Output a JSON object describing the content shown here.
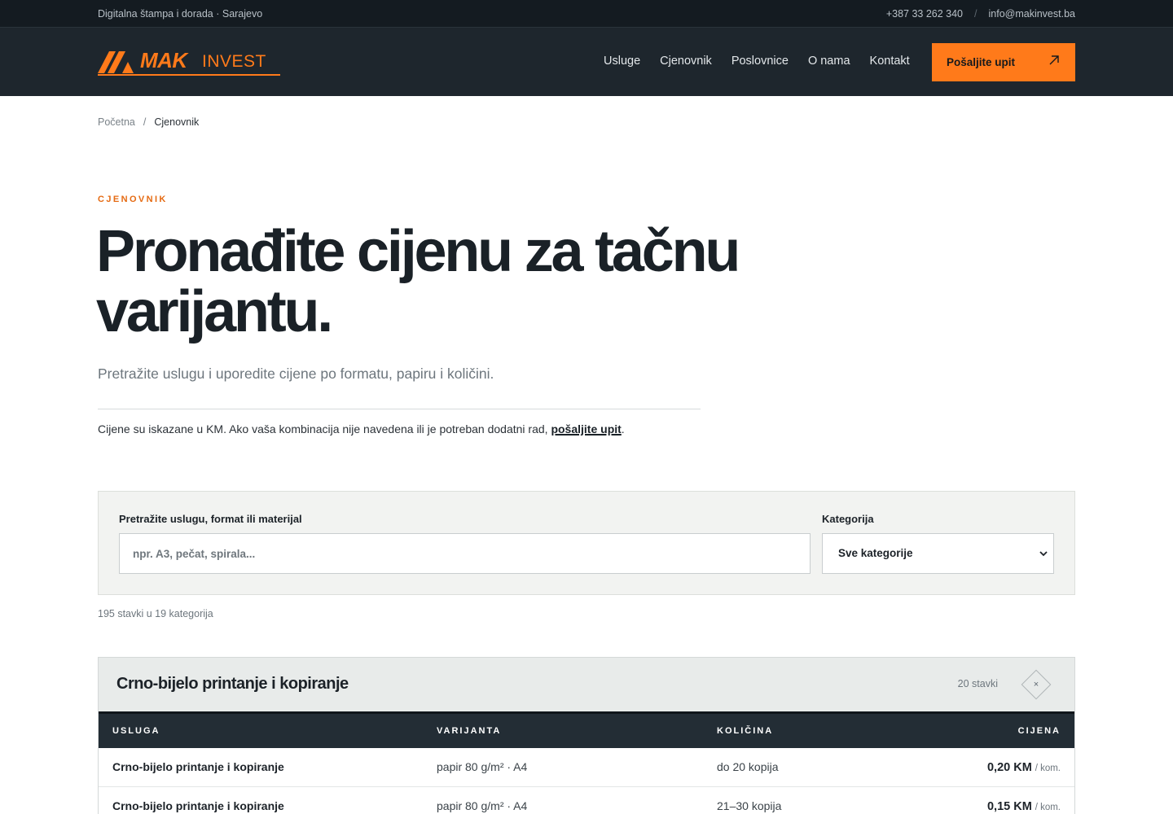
{
  "topbar": {
    "tagline": "Digitalna štampa i dorada · Sarajevo",
    "phone": "+387 33 262 340",
    "separator": "/",
    "email": "info@makinvest.ba"
  },
  "header": {
    "logo_mak": "MAK",
    "logo_invest": "INVEST",
    "nav": [
      "Usluge",
      "Cjenovnik",
      "Poslovnice",
      "O nama",
      "Kontakt"
    ],
    "cta_label": "Pošaljite upit",
    "accent_color": "#ff7a1a"
  },
  "breadcrumb": {
    "home": "Početna",
    "separator": "/",
    "current": "Cjenovnik"
  },
  "hero": {
    "eyebrow": "CJENOVNIK",
    "title": "Pronađite cijenu za tačnu varijantu.",
    "subtitle": "Pretražite uslugu i uporedite cijene po formatu, papiru i količini.",
    "note_before": "Cijene su iskazane u KM. Ako vaša kombinacija nije navedena ili je potreban dodatni rad, ",
    "note_link": "pošaljite upit",
    "note_after": "."
  },
  "filters": {
    "search_label": "Pretražite uslugu, format ili materijal",
    "search_placeholder": "npr. A3, pečat, spirala...",
    "search_value": "",
    "category_label": "Kategorija",
    "category_selected": "Sve kategorije"
  },
  "summary": "195 stavki u 19 kategorija",
  "category": {
    "title": "Crno-bijelo printanje i kopiranje",
    "count": "20 stavki",
    "toggle_icon": "×",
    "columns": [
      "USLUGA",
      "VARIJANTA",
      "KOLIČINA",
      "CIJENA"
    ],
    "rows": [
      {
        "service": "Crno-bijelo printanje i kopiranje",
        "variant": "papir 80 g/m² · A4",
        "quantity": "do 20 kopija",
        "price": "0,20 KM",
        "unit": "/ kom."
      },
      {
        "service": "Crno-bijelo printanje i kopiranje",
        "variant": "papir 80 g/m² · A4",
        "quantity": "21–30 kopija",
        "price": "0,15 KM",
        "unit": "/ kom."
      }
    ]
  }
}
